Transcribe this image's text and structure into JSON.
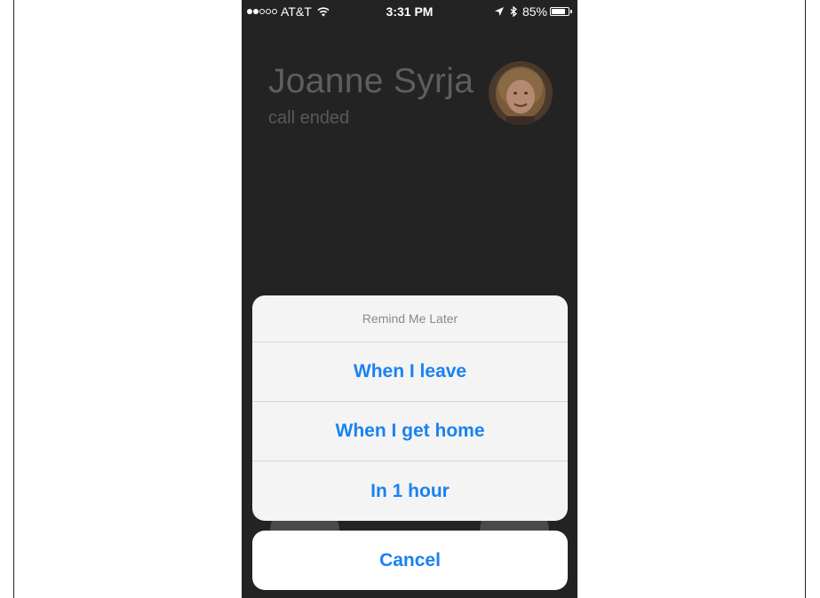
{
  "status_bar": {
    "carrier": "AT&T",
    "signal_bars_filled": 2,
    "signal_bars_total": 5,
    "time": "3:31 PM",
    "battery_percent_text": "85%",
    "battery_level": 0.85
  },
  "call": {
    "name": "Joanne Syrja",
    "status": "call ended"
  },
  "action_sheet": {
    "title": "Remind Me Later",
    "options": [
      {
        "label": "When I leave"
      },
      {
        "label": "When I get home"
      },
      {
        "label": "In 1 hour"
      }
    ],
    "cancel_label": "Cancel"
  },
  "colors": {
    "accent": "#1a82f0",
    "background": "#232323",
    "sheet": "#f4f4f4"
  },
  "icons": [
    "wifi-icon",
    "location-arrow-icon",
    "bluetooth-icon",
    "battery-icon"
  ]
}
